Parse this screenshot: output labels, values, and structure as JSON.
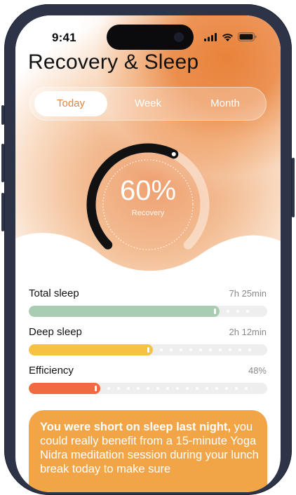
{
  "status_bar": {
    "time": "9:41"
  },
  "header": {
    "title": "Recovery & Sleep"
  },
  "tabs": [
    {
      "label": "Today",
      "selected": true
    },
    {
      "label": "Week",
      "selected": false
    },
    {
      "label": "Month",
      "selected": false
    }
  ],
  "recovery": {
    "percent_label": "60%",
    "label": "Recovery",
    "value": 0.6
  },
  "metrics": [
    {
      "label": "Total sleep",
      "value": "7h 25min",
      "fill_fraction": 0.8,
      "color": "#a8cdb2"
    },
    {
      "label": "Deep sleep",
      "value": "2h 12min",
      "fill_fraction": 0.52,
      "color": "#f7c244"
    },
    {
      "label": "Efficiency",
      "value": "48%",
      "fill_fraction": 0.3,
      "color": "#f06b3f"
    }
  ],
  "advice_card": {
    "bold": "You were short on sleep last night,",
    "rest": " you could really benefit from a 15-minute Yoga Nidra meditation session during your lunch break today to make sure"
  },
  "colors": {
    "accent_orange": "#e9823a",
    "card": "#f2a547",
    "ring": "#111111"
  }
}
